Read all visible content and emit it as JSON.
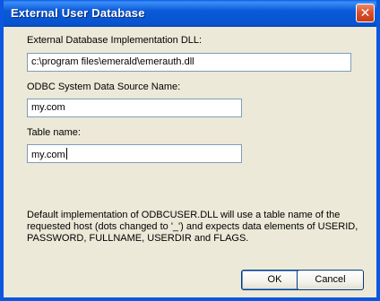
{
  "window": {
    "title": "External User Database",
    "close_glyph": "✕"
  },
  "form": {
    "dll_label": "External Database Implementation DLL:",
    "dll_value": "c:\\program files\\emerald\\emerauth.dll",
    "dsn_label": "ODBC System Data Source Name:",
    "dsn_value": "my.com",
    "table_label": "Table name:",
    "table_value": "my.com"
  },
  "description": "Default implementation of ODBCUSER.DLL will use a table name of the requested host (dots changed to '_') and expects data elements of USERID, PASSWORD, FULLNAME, USERDIR and FLAGS.",
  "buttons": {
    "ok": "OK",
    "cancel": "Cancel"
  },
  "colors": {
    "titlebar": "#0853d0",
    "dialog_bg": "#ece9d8",
    "close_button": "#d9522e",
    "field_border": "#7f9db9"
  }
}
